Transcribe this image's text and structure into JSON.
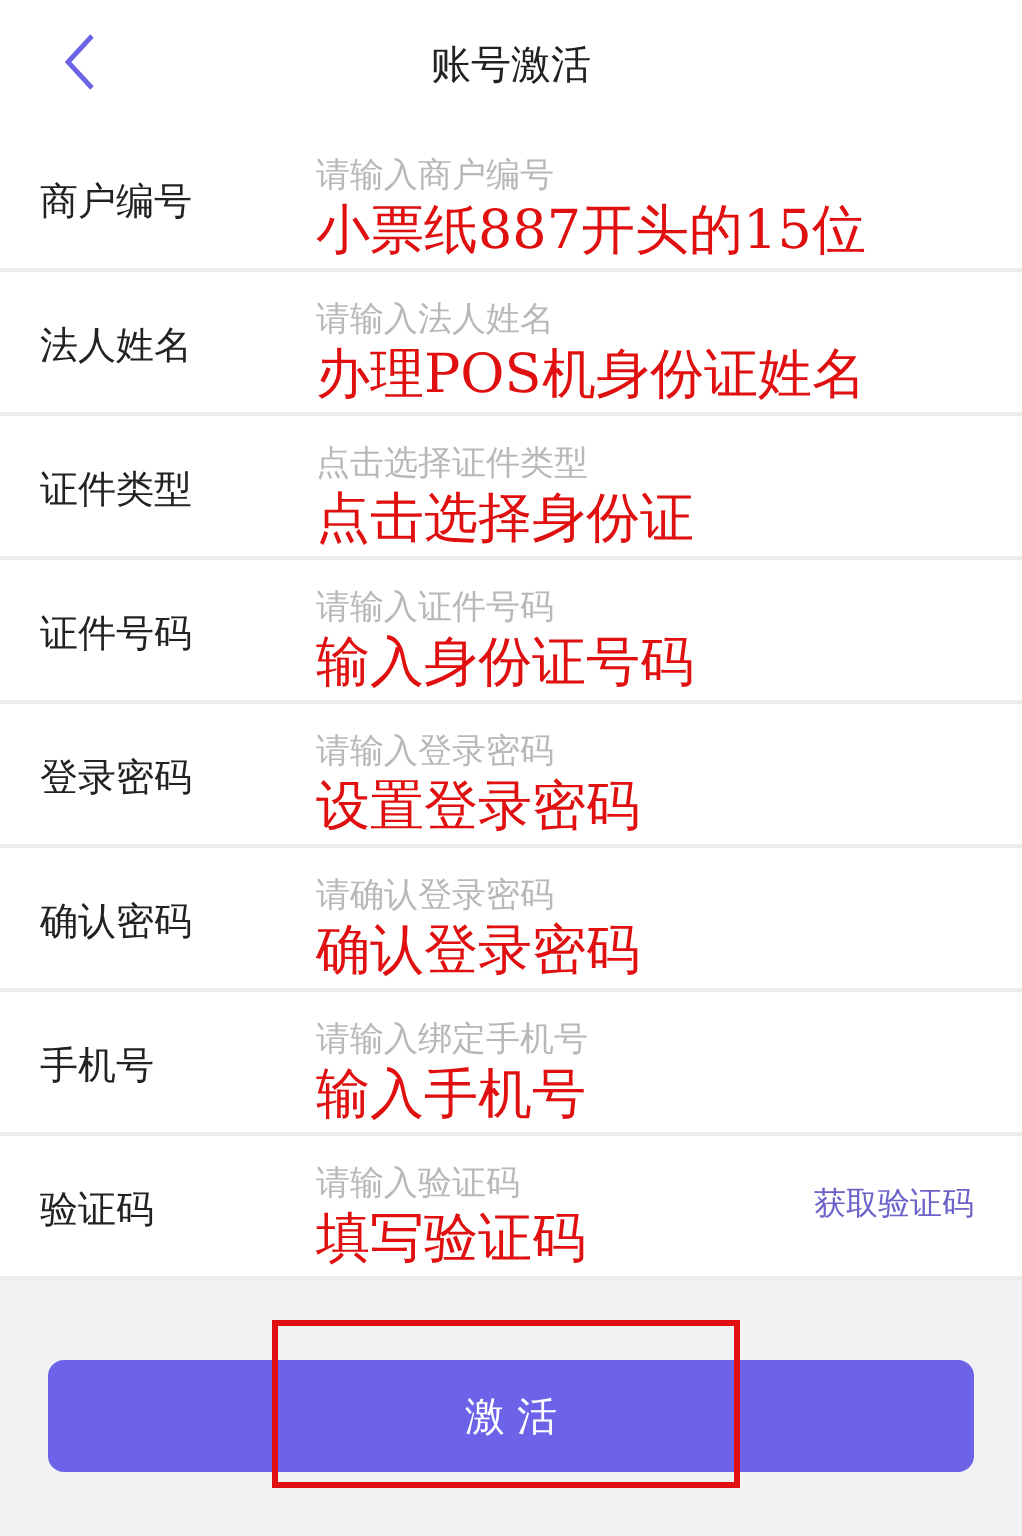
{
  "header": {
    "title": "账号激活"
  },
  "rows": [
    {
      "label": "商户编号",
      "placeholder": "请输入商户编号",
      "annotation": "小票纸887开头的15位"
    },
    {
      "label": "法人姓名",
      "placeholder": "请输入法人姓名",
      "annotation": "办理POS机身份证姓名"
    },
    {
      "label": "证件类型",
      "placeholder": "点击选择证件类型",
      "annotation": "点击选择身份证"
    },
    {
      "label": "证件号码",
      "placeholder": "请输入证件号码",
      "annotation": "输入身份证号码"
    },
    {
      "label": "登录密码",
      "placeholder": "请输入登录密码",
      "annotation": "设置登录密码"
    },
    {
      "label": "确认密码",
      "placeholder": "请确认登录密码",
      "annotation": "确认登录密码"
    },
    {
      "label": "手机号",
      "placeholder": "请输入绑定手机号",
      "annotation": "输入手机号"
    },
    {
      "label": "验证码",
      "placeholder": "请输入验证码",
      "annotation": "填写验证码",
      "action": "获取验证码"
    }
  ],
  "submit": {
    "label": "激 活",
    "highlighted": true
  }
}
